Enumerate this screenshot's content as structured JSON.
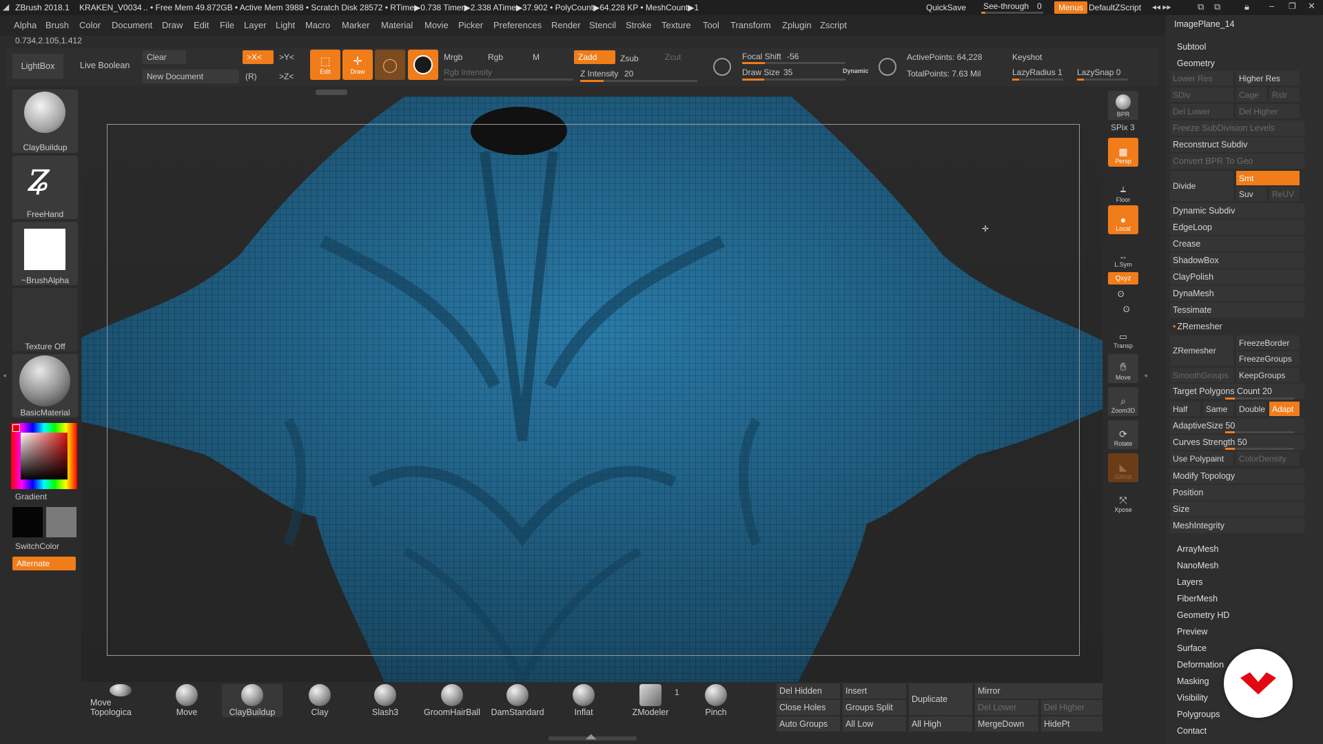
{
  "title_bar": {
    "app": "ZBrush 2018.1",
    "document": "KRAKEN_V0034",
    "stats": ".. • Free Mem 49.872GB • Active Mem 3988 • Scratch Disk 28572 • RTime▶0.738 Timer▶2.338 ATime▶37.902 • PolyCount▶64.228 KP • MeshCount▶1",
    "quicksave": "QuickSave",
    "see_through_label": "See-through",
    "see_through_value": "0",
    "menus": "Menus",
    "zscript": "DefaultZScript"
  },
  "menus": [
    "Alpha",
    "Brush",
    "Color",
    "Document",
    "Draw",
    "Edit",
    "File",
    "Layer",
    "Light",
    "Macro",
    "Marker",
    "Material",
    "Movie",
    "Picker",
    "Preferences",
    "Render",
    "Stencil",
    "Stroke",
    "Texture",
    "Tool",
    "Transform",
    "Zplugin",
    "Zscript"
  ],
  "coords": "0.734,2.105,1.412",
  "toolbar": {
    "lightbox": "LightBox",
    "live_boolean": "Live Boolean",
    "clear": "Clear",
    "new_document": "New Document",
    "x_sym": ">X<",
    "y_sym": ">Y<",
    "z_sym": ">Z<",
    "r_sym": "(R)",
    "edit": "Edit",
    "draw": "Draw",
    "mrgb": "Mrgb",
    "rgb": "Rgb",
    "m": "M",
    "zadd": "Zadd",
    "zsub": "Zsub",
    "zcut": "Zcut",
    "rgb_intensity": "Rgb Intensity",
    "z_intensity_label": "Z Intensity",
    "z_intensity": 20,
    "focal_shift_label": "Focal Shift",
    "focal_shift": -56,
    "draw_size_label": "Draw Size",
    "draw_size": 35,
    "dynamic": "Dynamic",
    "active_points": "ActivePoints: 64,228",
    "total_points": "TotalPoints: 7.63 Mil",
    "keyshot": "Keyshot",
    "lazy_radius": "LazyRadius 1",
    "lazy_snap": "LazySnap 0"
  },
  "left_shelf": {
    "brush": "ClayBuildup",
    "stroke": "FreeHand",
    "alpha": "~BrushAlpha",
    "texture": "Texture Off",
    "material": "BasicMaterial",
    "gradient": "Gradient",
    "switch_color": "SwitchColor",
    "alternate": "Alternate"
  },
  "right_strip": {
    "bpr": "BPR",
    "spix": "SPix 3",
    "persp": "Persp",
    "floor": "Floor",
    "local": "Local",
    "lsym": "L.Sym",
    "xyz": "Qxyz",
    "transp": "Transp",
    "move": "Move",
    "zoom3d": "Zoom3D",
    "rotate": "Rotate",
    "ghost": "Ghost",
    "xpose": "Xpose"
  },
  "palette": {
    "image_plane": "ImagePlane_14",
    "subtool": "Subtool",
    "geometry": "Geometry",
    "lower_res": "Lower Res",
    "higher_res": "Higher Res",
    "sdiv": "SDiv",
    "cage": "Cage",
    "rstr": "Rstr",
    "del_lower": "Del Lower",
    "del_higher": "Del Higher",
    "freeze_subdiv": "Freeze SubDivision Levels",
    "reconstruct": "Reconstruct Subdiv",
    "convert_bpr": "Convert BPR To Geo",
    "divide": "Divide",
    "smt": "Smt",
    "suv": "Suv",
    "reuv": "ReUV",
    "items_a": [
      "Dynamic Subdiv",
      "EdgeLoop",
      "Crease",
      "ShadowBox",
      "ClayPolish",
      "DynaMesh",
      "Tessimate"
    ],
    "zremesher_header": "ZRemesher",
    "zremesher": "ZRemesher",
    "freeze_border": "FreezeBorder",
    "freeze_groups": "FreezeGroups",
    "smooth_groups": "SmoothGroups",
    "keep_groups": "KeepGroups",
    "target_polys": "Target Polygons Count 20",
    "half": "Half",
    "same": "Same",
    "double": "Double",
    "adapt": "Adapt",
    "adaptive_size": "AdaptiveSize 50",
    "curves_strength": "Curves Strength 50",
    "use_polypaint": "Use Polypaint",
    "color_density": "ColorDensity",
    "items_b": [
      "Modify Topology",
      "Position",
      "Size",
      "MeshIntegrity"
    ],
    "submenus": [
      "ArrayMesh",
      "NanoMesh",
      "Layers",
      "FiberMesh",
      "Geometry HD",
      "Preview",
      "Surface",
      "Deformation",
      "Masking",
      "Visibility",
      "Polygroups",
      "Contact"
    ]
  },
  "bottom_shelf": {
    "brushes": [
      "Move Topologica",
      "Move",
      "ClayBuildup",
      "Clay",
      "Slash3",
      "GroomHairBall",
      "DamStandard",
      "Inflat",
      "ZModeler",
      "Pinch"
    ],
    "zmodeler_count": "1",
    "buttons": {
      "del_hidden": "Del Hidden",
      "insert": "Insert",
      "duplicate": "Duplicate",
      "mirror": "Mirror",
      "close_holes": "Close Holes",
      "groups_split": "Groups Split",
      "del_lower": "Del Lower",
      "del_higher": "Del Higher",
      "auto_groups": "Auto Groups",
      "all_low": "All Low",
      "all_high": "All High",
      "merge_down": "MergeDown",
      "hide_pt": "HidePt"
    }
  },
  "colors": {
    "accent": "#f07c1a",
    "mesh": "#2a7aa8",
    "badge": "#e30613"
  }
}
